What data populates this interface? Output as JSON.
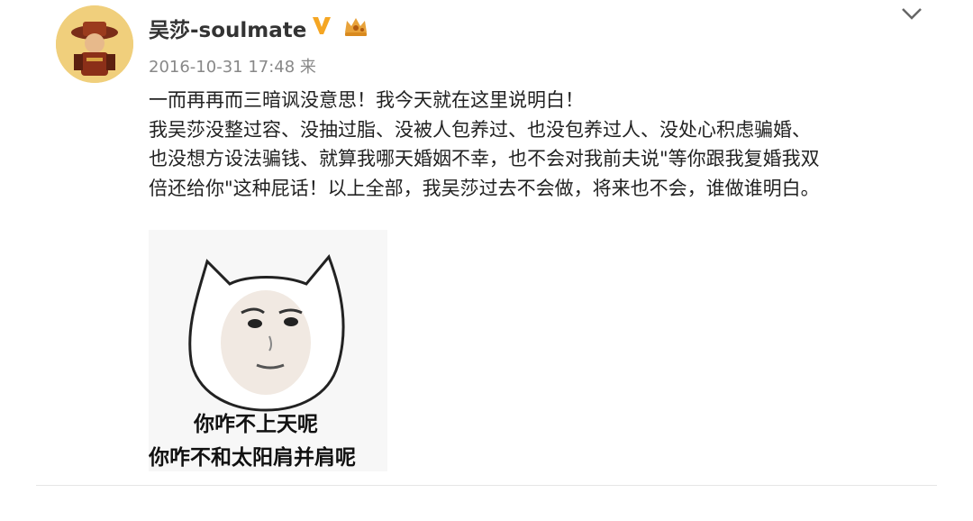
{
  "post": {
    "username": "吴莎-soulmate",
    "timestamp": "2016-10-31 17:48 来",
    "lines": [
      "一而再再而三暗讽没意思！我今天就在这里说明白！",
      "我吴莎没整过容、没抽过脂、没被人包养过、也没包养过人、没处心积虑骗婚、",
      "也没想方设法骗钱、就算我哪天婚姻不幸，也不会对我前夫说\"等你跟我复婚我双",
      "倍还给你\"这种屁话！以上全部，我吴莎过去不会做，将来也不会，谁做谁明白。"
    ],
    "meme": {
      "line1": "你咋不上天呢",
      "line2": "你咋不和太阳肩并肩呢"
    }
  },
  "colors": {
    "verified_badge": "#f5a623",
    "username": "#333333",
    "timestamp": "#888888"
  },
  "icons": {
    "verified": "verified-v-icon",
    "member": "crown-member-icon",
    "menu": "chevron-down-icon"
  }
}
